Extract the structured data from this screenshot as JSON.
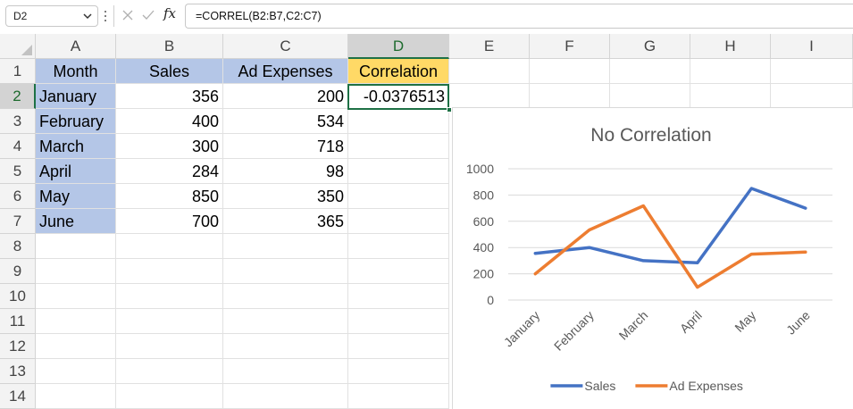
{
  "formula_bar": {
    "name_box": "D2",
    "formula": "=CORREL(B2:B7,C2:C7)",
    "fx_label": "fx"
  },
  "icons": {
    "name_box_dropdown": "chevron-down-icon",
    "cancel": "cancel-icon",
    "enter": "enter-icon",
    "function": "fx-icon"
  },
  "colors": {
    "selection": "#1e7145",
    "header_fill": "#b4c6e7",
    "correlation_fill": "#ffd966",
    "sales": "#4472c4",
    "ad_expenses": "#ed7d31"
  },
  "sheet": {
    "columns": [
      "A",
      "B",
      "C",
      "D",
      "E",
      "F",
      "G",
      "H",
      "I"
    ],
    "rows": [
      "1",
      "2",
      "3",
      "4",
      "5",
      "6",
      "7",
      "8",
      "9",
      "10",
      "11",
      "12",
      "13",
      "14"
    ],
    "selected_column": "D",
    "selected_row": "2",
    "headers": {
      "month": "Month",
      "sales": "Sales",
      "ad_expenses": "Ad Expenses",
      "correlation": "Correlation"
    },
    "correlation_value": "-0.0376513",
    "data": [
      {
        "month": "January",
        "sales": "356",
        "ad": "200"
      },
      {
        "month": "February",
        "sales": "400",
        "ad": "534"
      },
      {
        "month": "March",
        "sales": "300",
        "ad": "718"
      },
      {
        "month": "April",
        "sales": "284",
        "ad": "98"
      },
      {
        "month": "May",
        "sales": "850",
        "ad": "350"
      },
      {
        "month": "June",
        "sales": "700",
        "ad": "365"
      }
    ]
  },
  "chart_data": {
    "type": "line",
    "title": "No Correlation",
    "categories": [
      "January",
      "February",
      "March",
      "April",
      "May",
      "June"
    ],
    "series": [
      {
        "name": "Sales",
        "color": "#4472c4",
        "values": [
          356,
          400,
          300,
          284,
          850,
          700
        ]
      },
      {
        "name": "Ad Expenses",
        "color": "#ed7d31",
        "values": [
          200,
          534,
          718,
          98,
          350,
          365
        ]
      }
    ],
    "yticks": [
      "0",
      "200",
      "400",
      "600",
      "800",
      "1000"
    ],
    "ylim": [
      0,
      1000
    ],
    "grid": true,
    "legend": "bottom"
  }
}
